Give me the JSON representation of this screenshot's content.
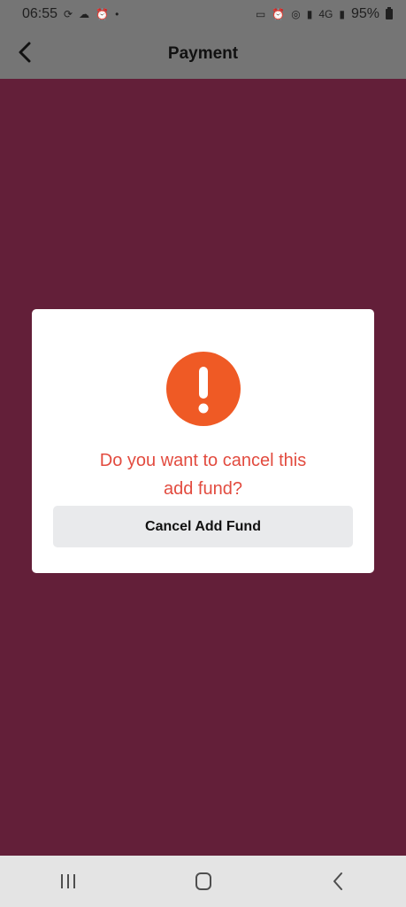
{
  "status_bar": {
    "time": "06:55",
    "battery_percent": "95%",
    "left_icons": [
      "sync-icon",
      "cloud-icon",
      "alarm-icon",
      "dot-icon"
    ],
    "right_icons": [
      "bed-icon",
      "alarm-icon",
      "hotspot-icon",
      "signal-icon",
      "4g-icon",
      "signal-icon",
      "battery-icon"
    ]
  },
  "app_bar": {
    "title": "Payment",
    "back_icon": "back-arrow-icon"
  },
  "dialog": {
    "message_line_1": "Do you want to cancel this",
    "message_line_2": "add fund?",
    "button_label": "Cancel Add Fund",
    "icon": "exclamation-icon"
  },
  "nav_bar": {
    "items": [
      "recent-apps-icon",
      "home-icon",
      "back-icon"
    ]
  },
  "colors": {
    "background": "#631f39",
    "header": "#757575",
    "alert": "#ef5a25",
    "message": "#e24b3f",
    "button": "#e9eaec"
  }
}
